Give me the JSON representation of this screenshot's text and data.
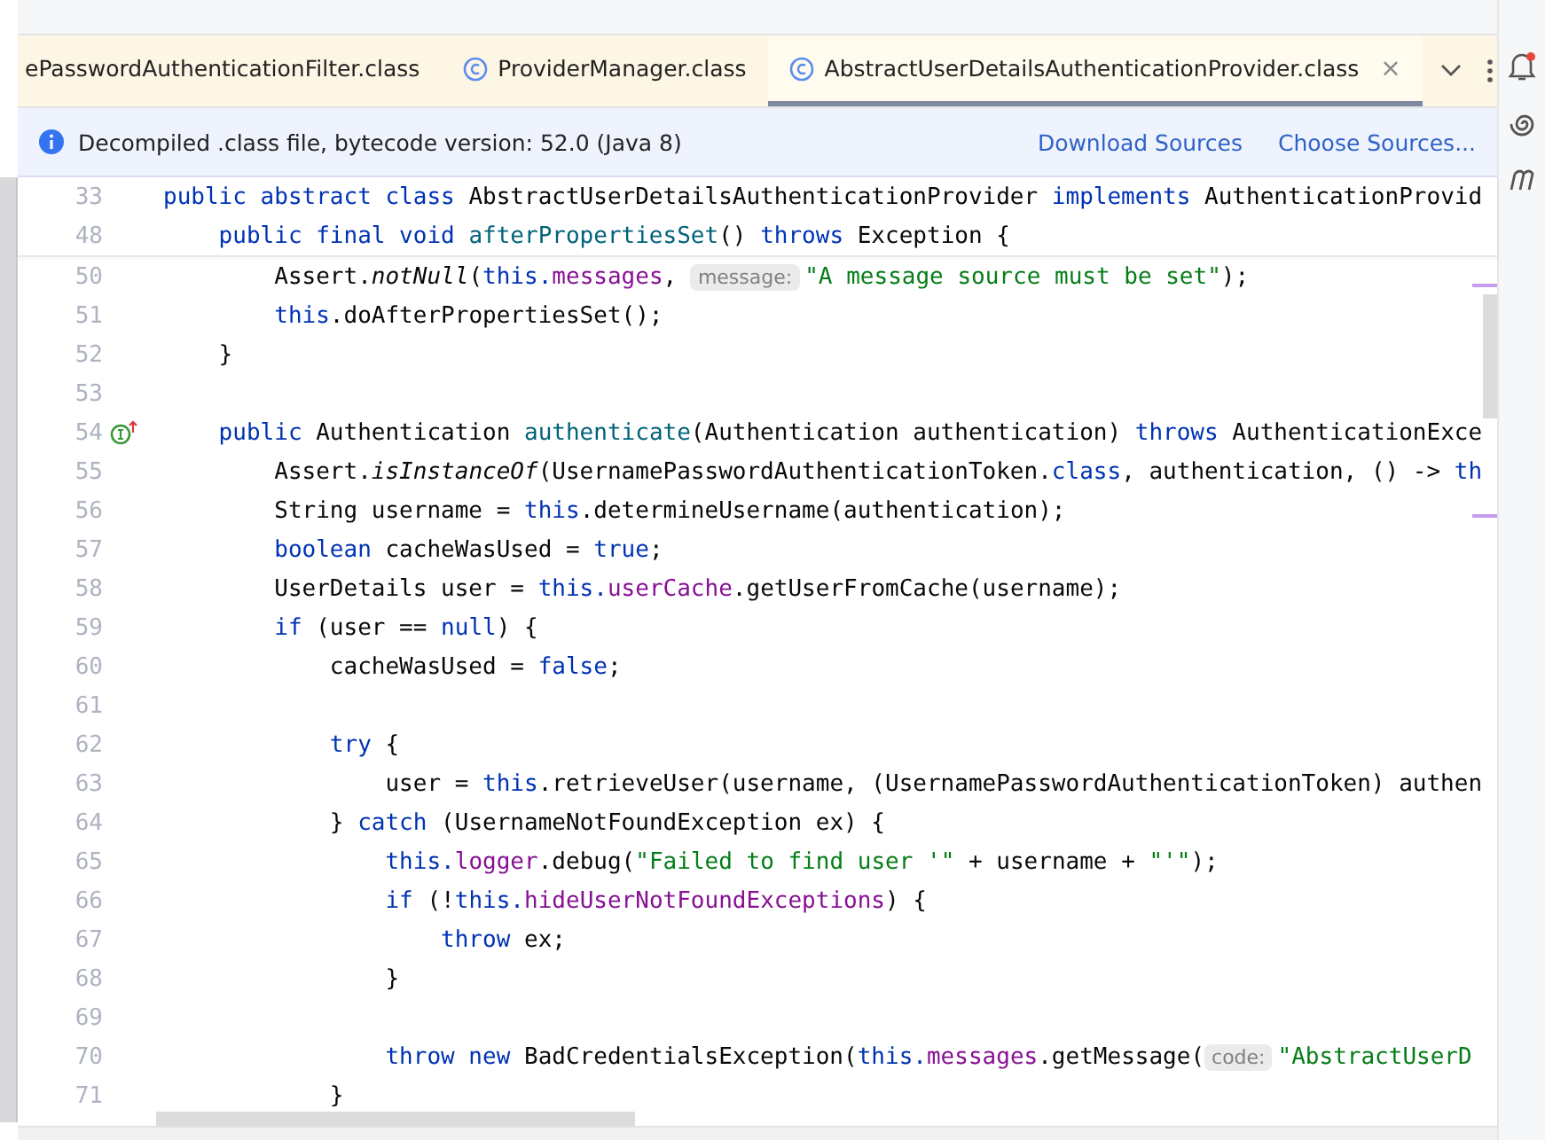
{
  "tabs": [
    {
      "label": "ePasswordAuthenticationFilter.class",
      "icon": false,
      "selected": false,
      "closable": false
    },
    {
      "label": "ProviderManager.class",
      "icon": true,
      "selected": false,
      "closable": false
    },
    {
      "label": "AbstractUserDetailsAuthenticationProvider.class",
      "icon": true,
      "selected": true,
      "closable": true
    }
  ],
  "tab_close": "×",
  "info_bar": {
    "message": "Decompiled .class file, bytecode version: 52.0 (Java 8)",
    "links": [
      "Download Sources",
      "Choose Sources..."
    ]
  },
  "sticky_lines": [
    {
      "number": "33",
      "tokens": [
        {
          "kind": "kw",
          "text": "public abstract class "
        },
        {
          "kind": "plain",
          "text": "AbstractUserDetailsAuthenticationProvider "
        },
        {
          "kind": "kw",
          "text": "implements "
        },
        {
          "kind": "plain",
          "text": "AuthenticationProvid"
        }
      ]
    },
    {
      "number": "48",
      "tokens": [
        {
          "kind": "kw",
          "text": "    public final void "
        },
        {
          "kind": "decl",
          "text": "afterPropertiesSet"
        },
        {
          "kind": "plain",
          "text": "() "
        },
        {
          "kind": "kw",
          "text": "throws "
        },
        {
          "kind": "plain",
          "text": "Exception {"
        }
      ]
    }
  ],
  "lines": [
    {
      "number": "50",
      "tokens": [
        {
          "kind": "plain",
          "text": "        Assert."
        },
        {
          "kind": "italic",
          "text": "notNull"
        },
        {
          "kind": "plain",
          "text": "("
        },
        {
          "kind": "kw",
          "text": "this."
        },
        {
          "kind": "field",
          "text": "messages"
        },
        {
          "kind": "plain",
          "text": ", "
        },
        {
          "kind": "hint",
          "text": "message:"
        },
        {
          "kind": "str",
          "text": "\"A message source must be set\""
        },
        {
          "kind": "plain",
          "text": ");"
        }
      ]
    },
    {
      "number": "51",
      "tokens": [
        {
          "kind": "kw",
          "text": "        this"
        },
        {
          "kind": "plain",
          "text": ".doAfterPropertiesSet();"
        }
      ]
    },
    {
      "number": "52",
      "tokens": [
        {
          "kind": "plain",
          "text": "    }"
        }
      ]
    },
    {
      "number": "53"
    },
    {
      "number": "54",
      "gutter_icon": true,
      "tokens": [
        {
          "kind": "kw",
          "text": "    public "
        },
        {
          "kind": "plain",
          "text": "Authentication "
        },
        {
          "kind": "decl",
          "text": "authenticate"
        },
        {
          "kind": "plain",
          "text": "(Authentication authentication) "
        },
        {
          "kind": "kw",
          "text": "throws "
        },
        {
          "kind": "plain",
          "text": "AuthenticationExce"
        }
      ]
    },
    {
      "number": "55",
      "tokens": [
        {
          "kind": "plain",
          "text": "        Assert."
        },
        {
          "kind": "italic",
          "text": "isInstanceOf"
        },
        {
          "kind": "plain",
          "text": "(UsernamePasswordAuthenticationToken."
        },
        {
          "kind": "kw",
          "text": "class"
        },
        {
          "kind": "plain",
          "text": ", authentication, () -> "
        },
        {
          "kind": "kw",
          "text": "th"
        }
      ]
    },
    {
      "number": "56",
      "tokens": [
        {
          "kind": "plain",
          "text": "        String username = "
        },
        {
          "kind": "kw",
          "text": "this"
        },
        {
          "kind": "plain",
          "text": ".determineUsername(authentication);"
        }
      ]
    },
    {
      "number": "57",
      "tokens": [
        {
          "kind": "kw",
          "text": "        boolean "
        },
        {
          "kind": "plain",
          "text": "cacheWasUsed = "
        },
        {
          "kind": "kw",
          "text": "true"
        },
        {
          "kind": "plain",
          "text": ";"
        }
      ]
    },
    {
      "number": "58",
      "tokens": [
        {
          "kind": "plain",
          "text": "        UserDetails user = "
        },
        {
          "kind": "kw",
          "text": "this."
        },
        {
          "kind": "field",
          "text": "userCache"
        },
        {
          "kind": "plain",
          "text": ".getUserFromCache(username);"
        }
      ]
    },
    {
      "number": "59",
      "tokens": [
        {
          "kind": "kw",
          "text": "        if "
        },
        {
          "kind": "plain",
          "text": "(user == "
        },
        {
          "kind": "kw",
          "text": "null"
        },
        {
          "kind": "plain",
          "text": ") {"
        }
      ]
    },
    {
      "number": "60",
      "tokens": [
        {
          "kind": "plain",
          "text": "            cacheWasUsed = "
        },
        {
          "kind": "kw",
          "text": "false"
        },
        {
          "kind": "plain",
          "text": ";"
        }
      ]
    },
    {
      "number": "61"
    },
    {
      "number": "62",
      "tokens": [
        {
          "kind": "kw",
          "text": "            try "
        },
        {
          "kind": "plain",
          "text": "{"
        }
      ]
    },
    {
      "number": "63",
      "tokens": [
        {
          "kind": "plain",
          "text": "                user = "
        },
        {
          "kind": "kw",
          "text": "this"
        },
        {
          "kind": "plain",
          "text": ".retrieveUser(username, (UsernamePasswordAuthenticationToken) authen"
        }
      ]
    },
    {
      "number": "64",
      "tokens": [
        {
          "kind": "plain",
          "text": "            } "
        },
        {
          "kind": "kw",
          "text": "catch "
        },
        {
          "kind": "plain",
          "text": "(UsernameNotFoundException ex) {"
        }
      ]
    },
    {
      "number": "65",
      "tokens": [
        {
          "kind": "kw",
          "text": "                this."
        },
        {
          "kind": "field",
          "text": "logger"
        },
        {
          "kind": "plain",
          "text": ".debug("
        },
        {
          "kind": "str",
          "text": "\"Failed to find user '\""
        },
        {
          "kind": "plain",
          "text": " + username + "
        },
        {
          "kind": "str",
          "text": "\"'\""
        },
        {
          "kind": "plain",
          "text": ");"
        }
      ]
    },
    {
      "number": "66",
      "tokens": [
        {
          "kind": "kw",
          "text": "                if "
        },
        {
          "kind": "plain",
          "text": "(!"
        },
        {
          "kind": "kw",
          "text": "this."
        },
        {
          "kind": "field",
          "text": "hideUserNotFoundExceptions"
        },
        {
          "kind": "plain",
          "text": ") {"
        }
      ]
    },
    {
      "number": "67",
      "tokens": [
        {
          "kind": "kw",
          "text": "                    throw "
        },
        {
          "kind": "plain",
          "text": "ex;"
        }
      ]
    },
    {
      "number": "68",
      "tokens": [
        {
          "kind": "plain",
          "text": "                }"
        }
      ]
    },
    {
      "number": "69"
    },
    {
      "number": "70",
      "tokens": [
        {
          "kind": "kw",
          "text": "                throw new "
        },
        {
          "kind": "plain",
          "text": "BadCredentialsException("
        },
        {
          "kind": "kw",
          "text": "this."
        },
        {
          "kind": "field",
          "text": "messages"
        },
        {
          "kind": "plain",
          "text": ".getMessage("
        },
        {
          "kind": "hint",
          "text": "code:"
        },
        {
          "kind": "str",
          "text": "\"AbstractUserD"
        }
      ]
    },
    {
      "number": "71",
      "tokens": [
        {
          "kind": "plain",
          "text": "            }"
        }
      ]
    }
  ]
}
